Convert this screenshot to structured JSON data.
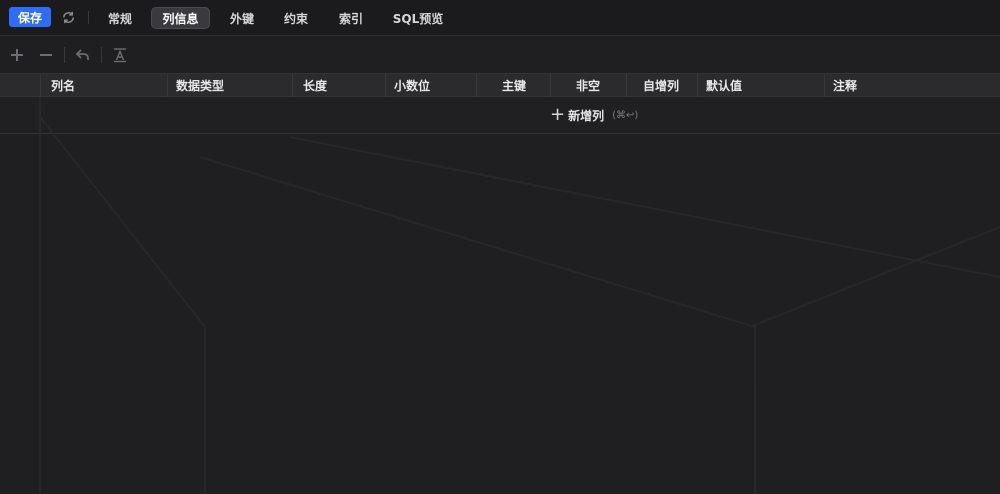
{
  "topbar": {
    "save_label": "保存",
    "tabs": [
      {
        "label": "常规",
        "active": false
      },
      {
        "label": "列信息",
        "active": true
      },
      {
        "label": "外键",
        "active": false
      },
      {
        "label": "约束",
        "active": false
      },
      {
        "label": "索引",
        "active": false
      },
      {
        "label": "SQL预览",
        "active": false
      }
    ]
  },
  "toolbar": {
    "icons": [
      "plus-icon",
      "minus-icon",
      "undo-icon",
      "text-format-icon"
    ]
  },
  "table": {
    "columns": [
      "列名",
      "数据类型",
      "长度",
      "小数位",
      "主键",
      "非空",
      "自增列",
      "默认值",
      "注释"
    ],
    "rows": []
  },
  "add_row": {
    "label": "新增列",
    "shortcut": "(⌘↩)"
  },
  "colors": {
    "accent": "#2f6df6",
    "background": "#1f1f21",
    "header_bg": "#2b2b2e"
  }
}
